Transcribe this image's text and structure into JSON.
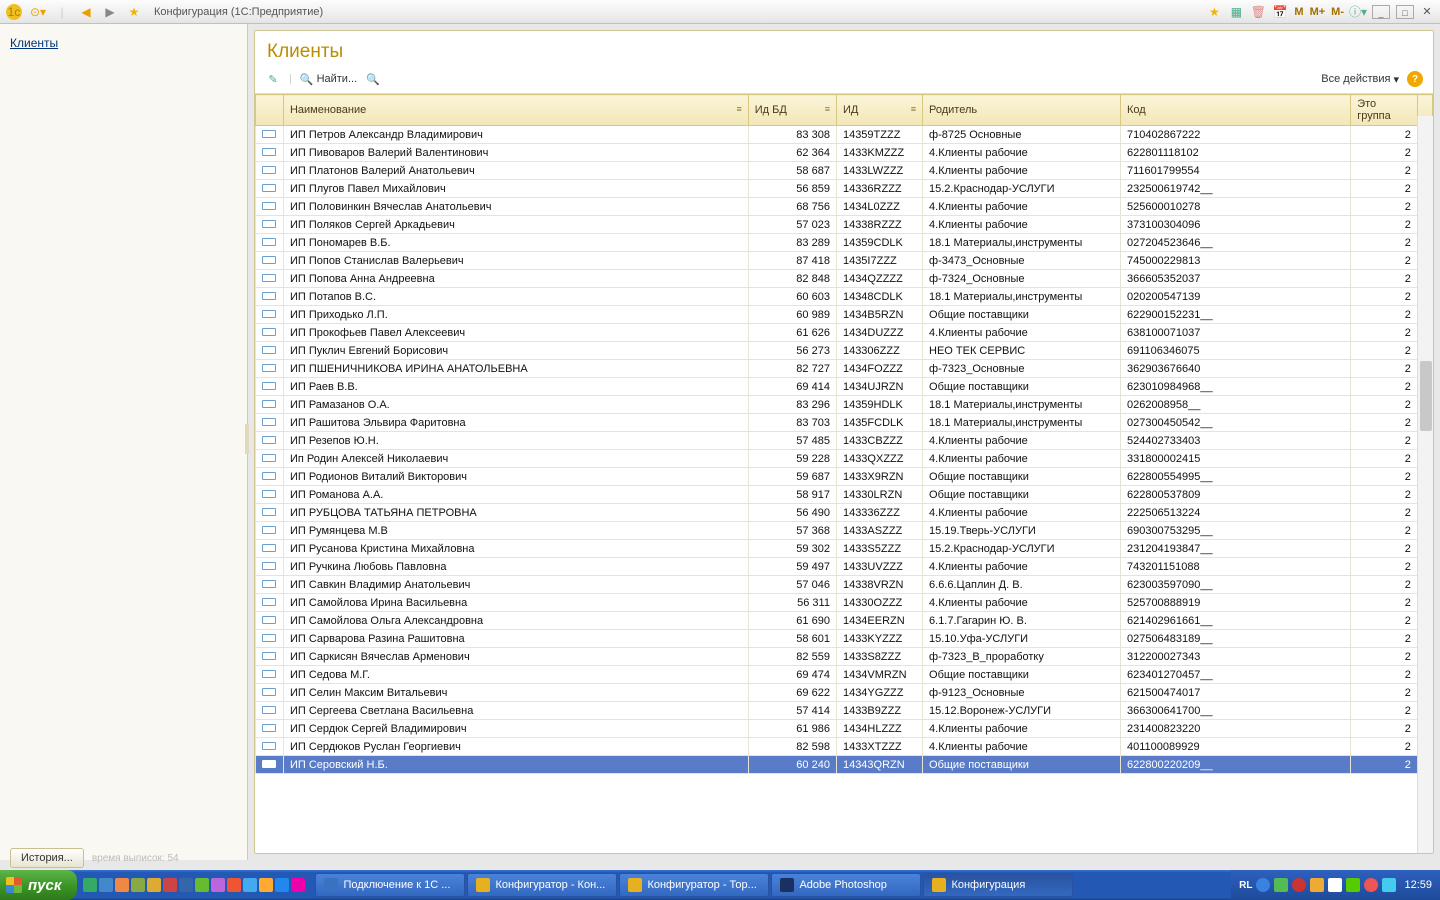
{
  "toolbar": {
    "title": "Конфигурация  (1С:Предприятие)"
  },
  "sidebar": {
    "link": "Клиенты"
  },
  "page": {
    "title": "Клиенты",
    "find_label": "Найти...",
    "all_actions": "Все действия"
  },
  "columns": {
    "name": "Наименование",
    "idbd": "Ид БД",
    "id": "ИД",
    "parent": "Родитель",
    "code": "Код",
    "group": "Это группа"
  },
  "rows": [
    {
      "n": "ИП Петров Александр Владимирович",
      "b": "83 308",
      "i": "14359TZZZ",
      "p": "ф-8725 Основные",
      "c": "710402867222",
      "g": "2"
    },
    {
      "n": "ИП Пивоваров Валерий Валентинович",
      "b": "62 364",
      "i": "1433KMZZZ",
      "p": "4.Клиенты рабочие",
      "c": "622801118102",
      "g": "2"
    },
    {
      "n": "ИП Платонов Валерий Анатольевич",
      "b": "58 687",
      "i": "1433LWZZZ",
      "p": "4.Клиенты рабочие",
      "c": "711601799554",
      "g": "2"
    },
    {
      "n": "ИП Плугов Павел Михайлович",
      "b": "56 859",
      "i": "14336RZZZ",
      "p": "15.2.Краснодар-УСЛУГИ",
      "c": "232500619742__",
      "g": "2"
    },
    {
      "n": "ИП Половинкин Вячеслав Анатольевич",
      "b": "68 756",
      "i": "1434L0ZZZ",
      "p": "4.Клиенты рабочие",
      "c": "525600010278",
      "g": "2"
    },
    {
      "n": "ИП Поляков Сергей Аркадьевич",
      "b": "57 023",
      "i": "14338RZZZ",
      "p": "4.Клиенты рабочие",
      "c": "373100304096",
      "g": "2"
    },
    {
      "n": "ИП Пономарев В.Б.",
      "b": "83 289",
      "i": "14359CDLK",
      "p": "18.1 Материалы,инструменты",
      "c": "027204523646__",
      "g": "2"
    },
    {
      "n": "ИП Попов Станислав Валерьевич",
      "b": "87 418",
      "i": "1435I7ZZZ",
      "p": "ф-3473_Основные",
      "c": "745000229813",
      "g": "2"
    },
    {
      "n": "ИП Попова Анна Андреевна",
      "b": "82 848",
      "i": "1434QZZZZ",
      "p": "ф-7324_Основные",
      "c": "366605352037",
      "g": "2"
    },
    {
      "n": "ИП Потапов В.С.",
      "b": "60 603",
      "i": "14348CDLK",
      "p": "18.1 Материалы,инструменты",
      "c": "020200547139",
      "g": "2"
    },
    {
      "n": "ИП Приходько Л.П.",
      "b": "60 989",
      "i": "1434B5RZN",
      "p": "Общие поставщики",
      "c": "622900152231__",
      "g": "2"
    },
    {
      "n": "ИП Прокофьев Павел Алексеевич",
      "b": "61 626",
      "i": "1434DUZZZ",
      "p": "4.Клиенты рабочие",
      "c": "638100071037",
      "g": "2"
    },
    {
      "n": "ИП Пуклич Евгений Борисович",
      "b": "56 273",
      "i": "143306ZZZ",
      "p": "НЕО ТЕК СЕРВИС",
      "c": "691106346075",
      "g": "2"
    },
    {
      "n": "ИП ПШЕНИЧНИКОВА ИРИНА АНАТОЛЬЕВНА",
      "b": "82 727",
      "i": "1434FOZZZ",
      "p": "ф-7323_Основные",
      "c": "362903676640",
      "g": "2"
    },
    {
      "n": "ИП Раев В.В.",
      "b": "69 414",
      "i": "1434UJRZN",
      "p": "Общие поставщики",
      "c": "623010984968__",
      "g": "2"
    },
    {
      "n": "ИП Рамазанов О.А.",
      "b": "83 296",
      "i": "14359HDLK",
      "p": "18.1 Материалы,инструменты",
      "c": "0262008958__",
      "g": "2"
    },
    {
      "n": "ИП Рашитова Эльвира Фаритовна",
      "b": "83 703",
      "i": "1435FCDLK",
      "p": "18.1 Материалы,инструменты",
      "c": "027300450542__",
      "g": "2"
    },
    {
      "n": "ИП Резепов Ю.Н.",
      "b": "57 485",
      "i": "1433CBZZZ",
      "p": "4.Клиенты рабочие",
      "c": "524402733403",
      "g": "2"
    },
    {
      "n": "Ип Родин Алексей Николаевич",
      "b": "59 228",
      "i": "1433QXZZZ",
      "p": "4.Клиенты рабочие",
      "c": "331800002415",
      "g": "2"
    },
    {
      "n": "ИП Родионов Виталий Викторович",
      "b": "59 687",
      "i": "1433X9RZN",
      "p": "Общие поставщики",
      "c": "622800554995__",
      "g": "2"
    },
    {
      "n": "ИП Романова А.А.",
      "b": "58 917",
      "i": "14330LRZN",
      "p": "Общие поставщики",
      "c": "622800537809",
      "g": "2"
    },
    {
      "n": "ИП РУБЦОВА ТАТЬЯНА ПЕТРОВНА",
      "b": "56 490",
      "i": "143336ZZZ",
      "p": "4.Клиенты рабочие",
      "c": "222506513224",
      "g": "2"
    },
    {
      "n": "ИП Румянцева М.В",
      "b": "57 368",
      "i": "1433ASZZZ",
      "p": "15.19.Тверь-УСЛУГИ",
      "c": "690300753295__",
      "g": "2"
    },
    {
      "n": "ИП Русанова Кристина Михайловна",
      "b": "59 302",
      "i": "1433S5ZZZ",
      "p": "15.2.Краснодар-УСЛУГИ",
      "c": "231204193847__",
      "g": "2"
    },
    {
      "n": "ИП Ручкина Любовь Павловна",
      "b": "59 497",
      "i": "1433UVZZZ",
      "p": "4.Клиенты рабочие",
      "c": "743201151088",
      "g": "2"
    },
    {
      "n": "ИП Савкин Владимир Анатольевич",
      "b": "57 046",
      "i": "14338VRZN",
      "p": "6.6.6.Цаплин Д. В.",
      "c": "623003597090__",
      "g": "2"
    },
    {
      "n": "ИП Самойлова Ирина Васильевна",
      "b": "56 311",
      "i": "14330OZZZ",
      "p": "4.Клиенты рабочие",
      "c": "525700888919",
      "g": "2"
    },
    {
      "n": "ИП Самойлова Ольга Александровна",
      "b": "61 690",
      "i": "1434EERZN",
      "p": "6.1.7.Гагарин Ю. В.",
      "c": "621402961661__",
      "g": "2"
    },
    {
      "n": "ИП Сарварова Разина Рашитовна",
      "b": "58 601",
      "i": "1433KYZZZ",
      "p": "15.10.Уфа-УСЛУГИ",
      "c": "027506483189__",
      "g": "2"
    },
    {
      "n": "ИП Саркисян Вячеслав Арменович",
      "b": "82 559",
      "i": "1433S8ZZZ",
      "p": "ф-7323_В_проработку",
      "c": "312200027343",
      "g": "2"
    },
    {
      "n": "ИП Седова М.Г.",
      "b": "69 474",
      "i": "1434VMRZN",
      "p": "Общие поставщики",
      "c": "623401270457__",
      "g": "2"
    },
    {
      "n": "ИП Селин Максим Витальевич",
      "b": "69 622",
      "i": "1434YGZZZ",
      "p": "ф-9123_Основные",
      "c": "621500474017",
      "g": "2"
    },
    {
      "n": "ИП Сергеева Светлана Васильевна",
      "b": "57 414",
      "i": "1433B9ZZZ",
      "p": "15.12.Воронеж-УСЛУГИ",
      "c": "366300641700__",
      "g": "2"
    },
    {
      "n": "ИП Сердюк Сергей Владимирович",
      "b": "61 986",
      "i": "1434HLZZZ",
      "p": "4.Клиенты рабочие",
      "c": "231400823220",
      "g": "2"
    },
    {
      "n": "ИП Сердюков Руслан Георгиевич",
      "b": "82 598",
      "i": "1433XTZZZ",
      "p": "4.Клиенты рабочие",
      "c": "401100089929",
      "g": "2"
    },
    {
      "n": "ИП Серовский Н.Б.",
      "b": "60 240",
      "i": "14343QRZN",
      "p": "Общие поставщики",
      "c": "622800220209__",
      "g": "2",
      "sel": true
    }
  ],
  "history": {
    "label": "История...",
    "faded": "время выписок: 54"
  },
  "taskbar": {
    "start": "пуск",
    "items": [
      {
        "label": "Подключение к 1С ...",
        "color": "#3a72c2"
      },
      {
        "label": "Конфигуратор - Кон...",
        "color": "#e6b020"
      },
      {
        "label": "Конфигуратор - Тор...",
        "color": "#e6b020"
      },
      {
        "label": "Adobe Photoshop",
        "color": "#1a3060"
      },
      {
        "label": "Конфигурация",
        "color": "#e6b020",
        "active": true
      }
    ],
    "lang": "RL",
    "time": "12:59"
  }
}
